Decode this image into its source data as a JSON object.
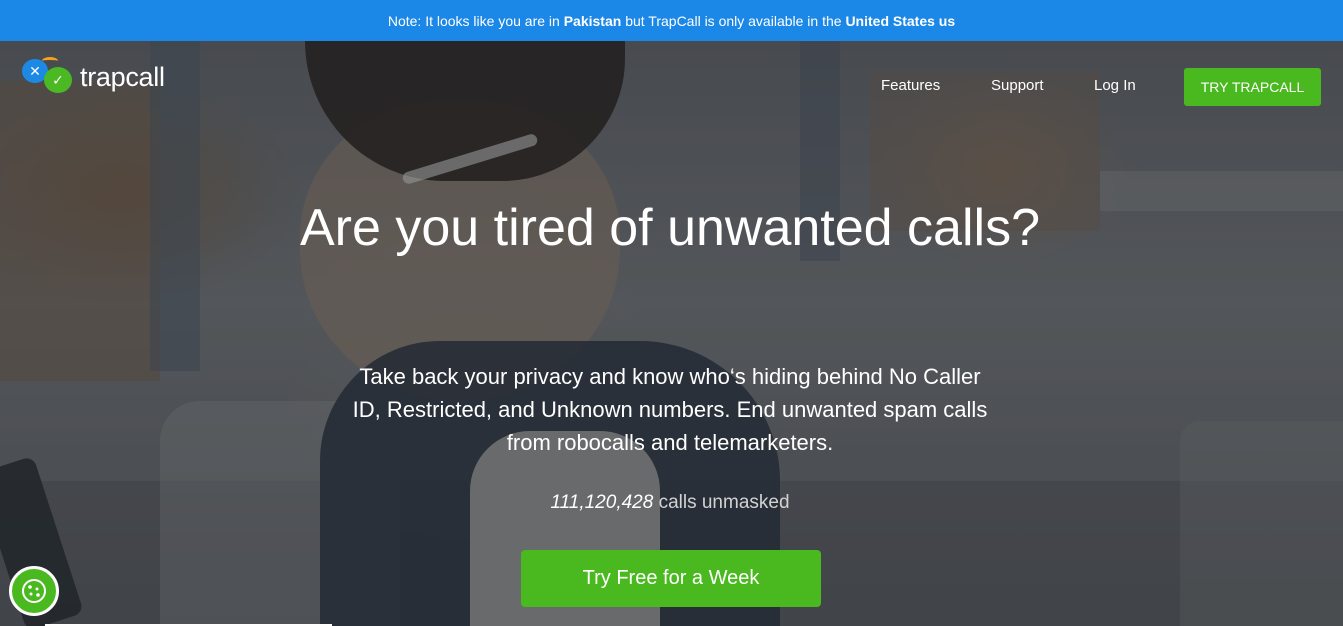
{
  "notice": {
    "prefix": "Note: It looks like you are in",
    "country": "Pakistan",
    "middle": "but TrapCall is only available in the",
    "available": "United States",
    "flag": "us"
  },
  "brand": {
    "name": "trapcall",
    "logo_icon": "trapcall-logo-icon",
    "colors": {
      "blue": "#1d89e4",
      "green": "#4ab91f",
      "orange": "#f4a21c"
    }
  },
  "nav": {
    "items": [
      {
        "label": "Features"
      },
      {
        "label": "Support"
      },
      {
        "label": "Log In"
      }
    ],
    "cta_label": "TRY TRAPCALL"
  },
  "hero": {
    "headline": "Are you tired of unwanted calls?",
    "subtext": "Take back your privacy and know who‘s hiding behind No Caller ID, Restricted, and Unknown numbers. End unwanted spam calls from robocalls and telemarketers.",
    "counter_value": "111,120,428",
    "counter_label": "calls unmasked",
    "cta_label": "Try Free for a Week"
  },
  "cookie_button": {
    "icon": "cookie-icon"
  }
}
